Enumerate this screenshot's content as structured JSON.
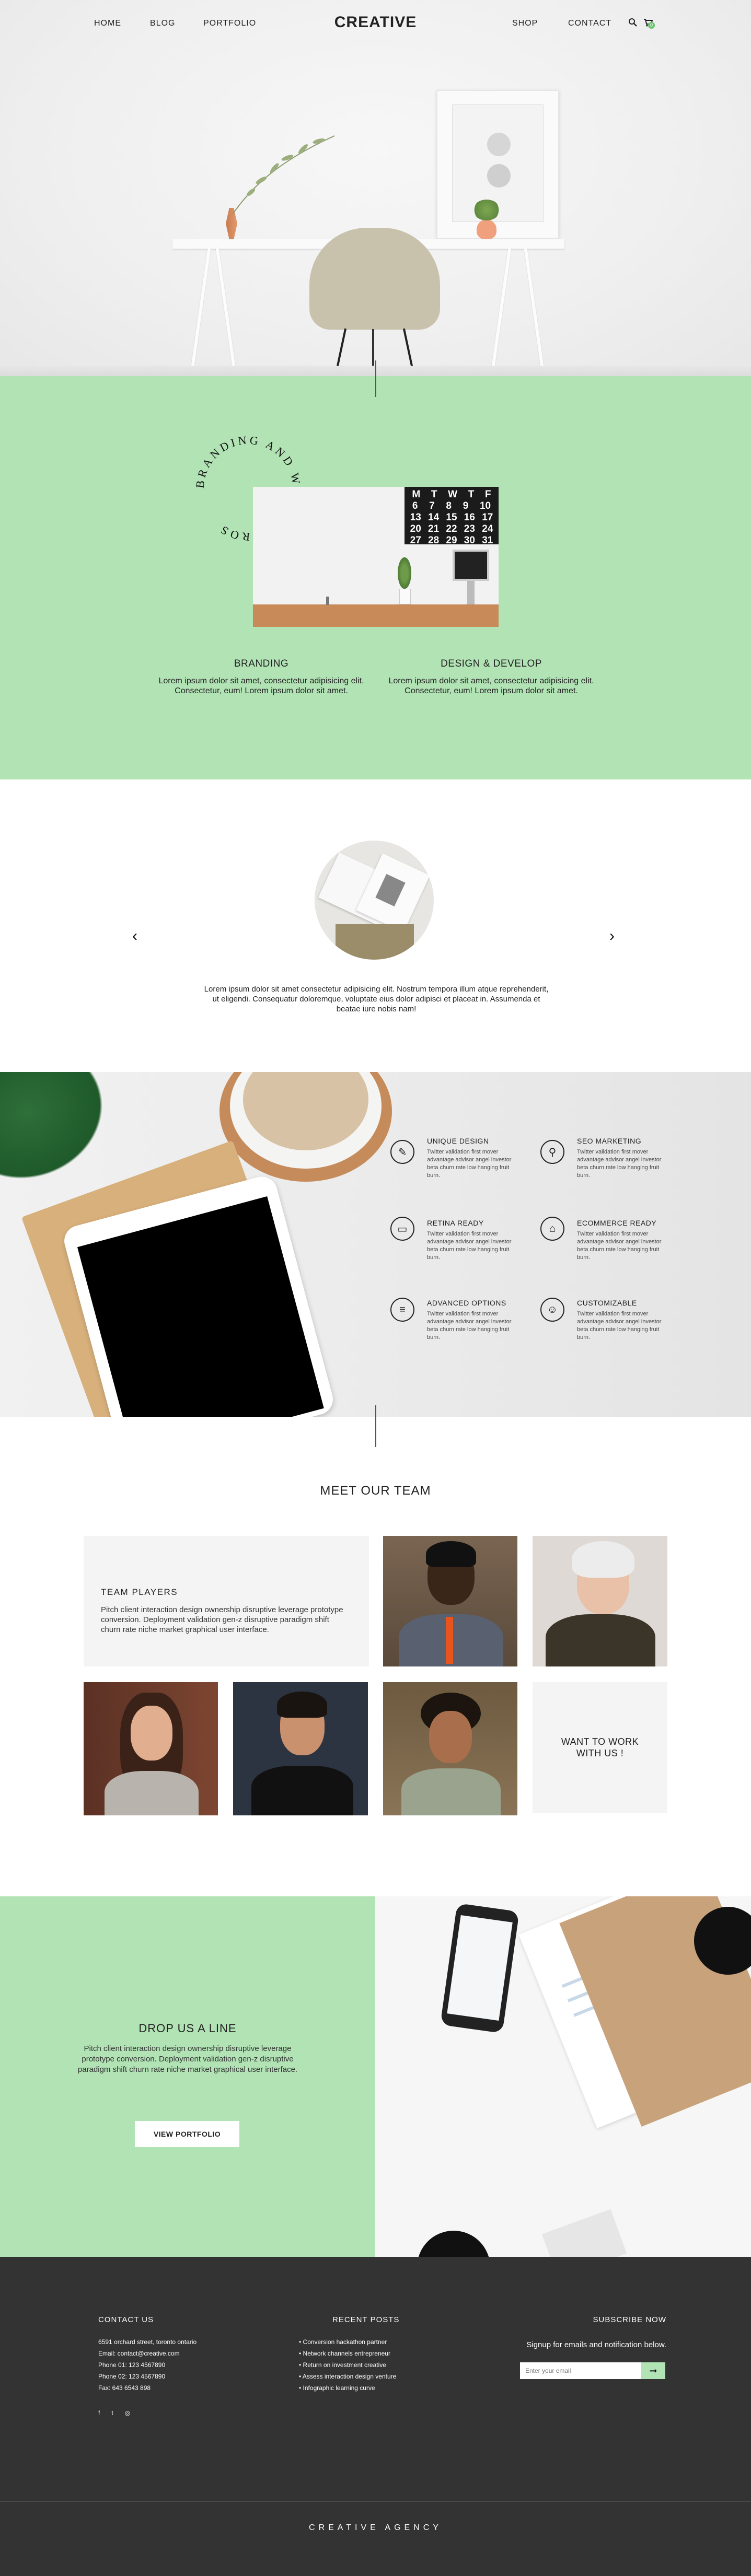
{
  "header": {
    "nav_left": [
      "HOME",
      "BLOG",
      "PORTFOLIO"
    ],
    "logo": "CREATIVE",
    "nav_right": [
      "SHOP",
      "CONTACT"
    ],
    "search_icon": "search-icon",
    "cart_icon": "cart-icon",
    "cart_count": "0"
  },
  "branding": {
    "circle_text": "BRANDING AND WEBSITE PROS",
    "calendar": {
      "row1": [
        "M",
        "T",
        "W",
        "T",
        "F"
      ],
      "row2": [
        "6",
        "7",
        "8",
        "9",
        "10"
      ],
      "row3": [
        "13",
        "14",
        "15",
        "16",
        "17"
      ],
      "row4": [
        "20",
        "21",
        "22",
        "23",
        "24"
      ],
      "row5": [
        "27",
        "28",
        "29",
        "30",
        "31"
      ]
    },
    "services": [
      {
        "title": "BRANDING",
        "text": "Lorem ipsum dolor sit amet, consectetur adipisicing elit. Consectetur, eum! Lorem ipsum dolor sit amet."
      },
      {
        "title": "DESIGN & DEVELOP",
        "text": "Lorem ipsum dolor sit amet, consectetur adipisicing elit. Consectetur, eum! Lorem ipsum dolor sit amet."
      }
    ]
  },
  "testimonial": {
    "text": "Lorem ipsum dolor sit amet consectetur adipisicing elit. Nostrum tempora illum atque reprehenderit, ut eligendi. Consequatur doloremque, voluptate eius dolor adipisci et placeat in. Assumenda et beatae iure nobis nam!",
    "prev": "‹",
    "next": "›"
  },
  "features": [
    {
      "icon": "pointer-icon",
      "glyph": "✎",
      "title": "UNIQUE DESIGN",
      "text": "Twitter validation first mover advantage advisor angel investor beta churn rate low hanging fruit burn."
    },
    {
      "icon": "pin-icon",
      "glyph": "⚲",
      "title": "SEO MARKETING",
      "text": "Twitter validation first mover advantage advisor angel investor beta churn rate low hanging fruit burn."
    },
    {
      "icon": "monitor-icon",
      "glyph": "▭",
      "title": "RETINA READY",
      "text": "Twitter validation first mover advantage advisor angel investor beta churn rate low hanging fruit burn."
    },
    {
      "icon": "basket-icon",
      "glyph": "⌂",
      "title": "ECOMMERCE READY",
      "text": "Twitter validation first mover advantage advisor angel investor beta churn rate low hanging fruit burn."
    },
    {
      "icon": "list-icon",
      "glyph": "≡",
      "title": "ADVANCED OPTIONS",
      "text": "Twitter validation first mover advantage advisor angel investor beta churn rate low hanging fruit burn."
    },
    {
      "icon": "smile-icon",
      "glyph": "☺",
      "title": "CUSTOMIZABLE",
      "text": "Twitter validation first mover advantage advisor angel investor beta churn rate low hanging fruit burn."
    }
  ],
  "team": {
    "title": "MEET OUR TEAM",
    "card_title": "TEAM PLAYERS",
    "card_text": "Pitch client interaction design ownership disruptive leverage prototype conversion. Deployment validation gen-z disruptive paradigm shift churn rate niche market graphical user interface.",
    "cta": "WANT TO WORK WITH US !"
  },
  "contact": {
    "title": "DROP US A LINE",
    "text": "Pitch client interaction design ownership disruptive leverage prototype conversion. Deployment validation gen-z disruptive paradigm shift churn rate niche market graphical user interface.",
    "button": "VIEW PORTFOLIO"
  },
  "footer": {
    "contact_title": "CONTACT US",
    "contact_lines": [
      "6591 orchard street, toronto ontario",
      "Email: contact@creative.com",
      "Phone 01: 123 4567890",
      "Phone 02: 123 4567890",
      "Fax: 643 6543 898"
    ],
    "social": [
      "f",
      "t",
      "◎"
    ],
    "posts_title": "RECENT POSTS",
    "posts": [
      "Conversion hackathon partner",
      "Network channels entrepreneur",
      "Return on investment creative",
      "Assess interaction design venture",
      "Infographic learning curve"
    ],
    "subscribe_title": "SUBSCRIBE NOW",
    "subscribe_text": "Signup for emails and notification below.",
    "email_placeholder": "Enter your email",
    "submit": "➞",
    "bottom": "CREATIVE AGENCY"
  },
  "colors": {
    "accent": "#b2e3b5",
    "footer": "#333333"
  }
}
